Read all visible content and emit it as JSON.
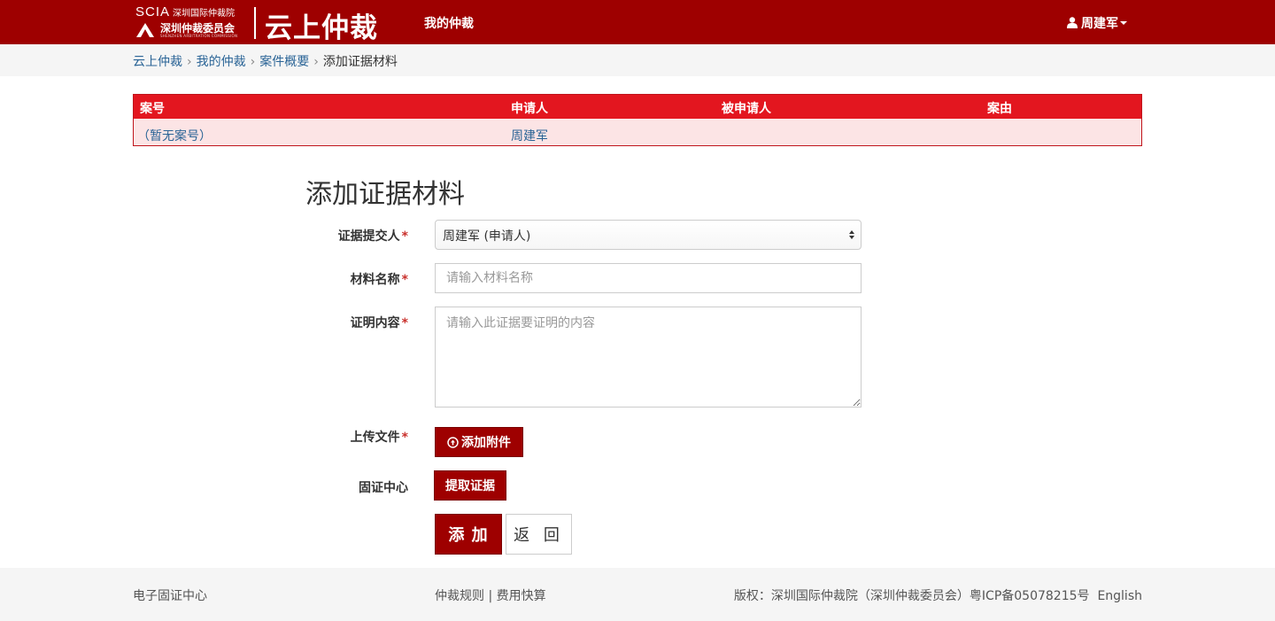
{
  "header": {
    "logo_abbr": "SCIA",
    "logo_cn_small": "深圳国际仲裁院",
    "logo_cn": "深圳仲裁委员会",
    "logo_en": "SHENZHEN ARBITRATION COMMISSION",
    "brand": "云上仲裁",
    "nav_my": "我的仲裁",
    "user_name": "周建军"
  },
  "breadcrumb": {
    "items": [
      "云上仲裁",
      "我的仲裁",
      "案件概要"
    ],
    "current": "添加证据材料"
  },
  "case_table": {
    "headers": [
      "案号",
      "申请人",
      "被申请人",
      "案由"
    ],
    "row": [
      "（暂无案号）",
      "周建军",
      "",
      ""
    ]
  },
  "form": {
    "title": "添加证据材料",
    "submitter_label": "证据提交人",
    "submitter_value": "周建军 (申请人)",
    "material_label": "材料名称",
    "material_placeholder": "请输入材料名称",
    "content_label": "证明内容",
    "content_placeholder": "请输入此证据要证明的内容",
    "upload_label": "上传文件",
    "upload_button": "添加附件",
    "center_label": "固证中心",
    "extract_button": "提取证据",
    "add_button": "添 加",
    "back_button": "返 回",
    "required_mark": "*"
  },
  "footer": {
    "left": "电子固证中心",
    "rules": "仲裁规则",
    "divider": "|",
    "fees": "费用快算",
    "copyright": "版权：深圳国际仲裁院（深圳仲裁委员会）粤ICP备05078215号",
    "language": "English"
  },
  "colors": {
    "header_bg": "#9e0000",
    "table_header_bg": "#e3161f",
    "table_row_bg": "#fce4e5",
    "link": "#2a6496"
  }
}
